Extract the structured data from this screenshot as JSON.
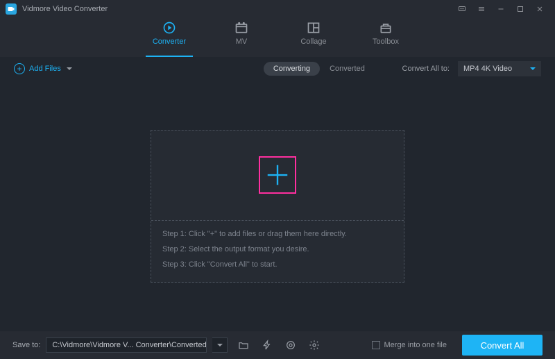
{
  "app": {
    "title": "Vidmore Video Converter"
  },
  "tabs": {
    "converter": "Converter",
    "mv": "MV",
    "collage": "Collage",
    "toolbox": "Toolbox"
  },
  "toolbar": {
    "add_files": "Add Files",
    "converting": "Converting",
    "converted": "Converted",
    "convert_all_to": "Convert All to:",
    "format_selected": "MP4 4K Video"
  },
  "dropzone": {
    "step1": "Step 1: Click \"+\" to add files or drag them here directly.",
    "step2": "Step 2: Select the output format you desire.",
    "step3": "Step 3: Click \"Convert All\" to start."
  },
  "bottom": {
    "save_to": "Save to:",
    "path": "C:\\Vidmore\\Vidmore V... Converter\\Converted",
    "merge_label": "Merge into one file",
    "convert_all": "Convert All"
  }
}
